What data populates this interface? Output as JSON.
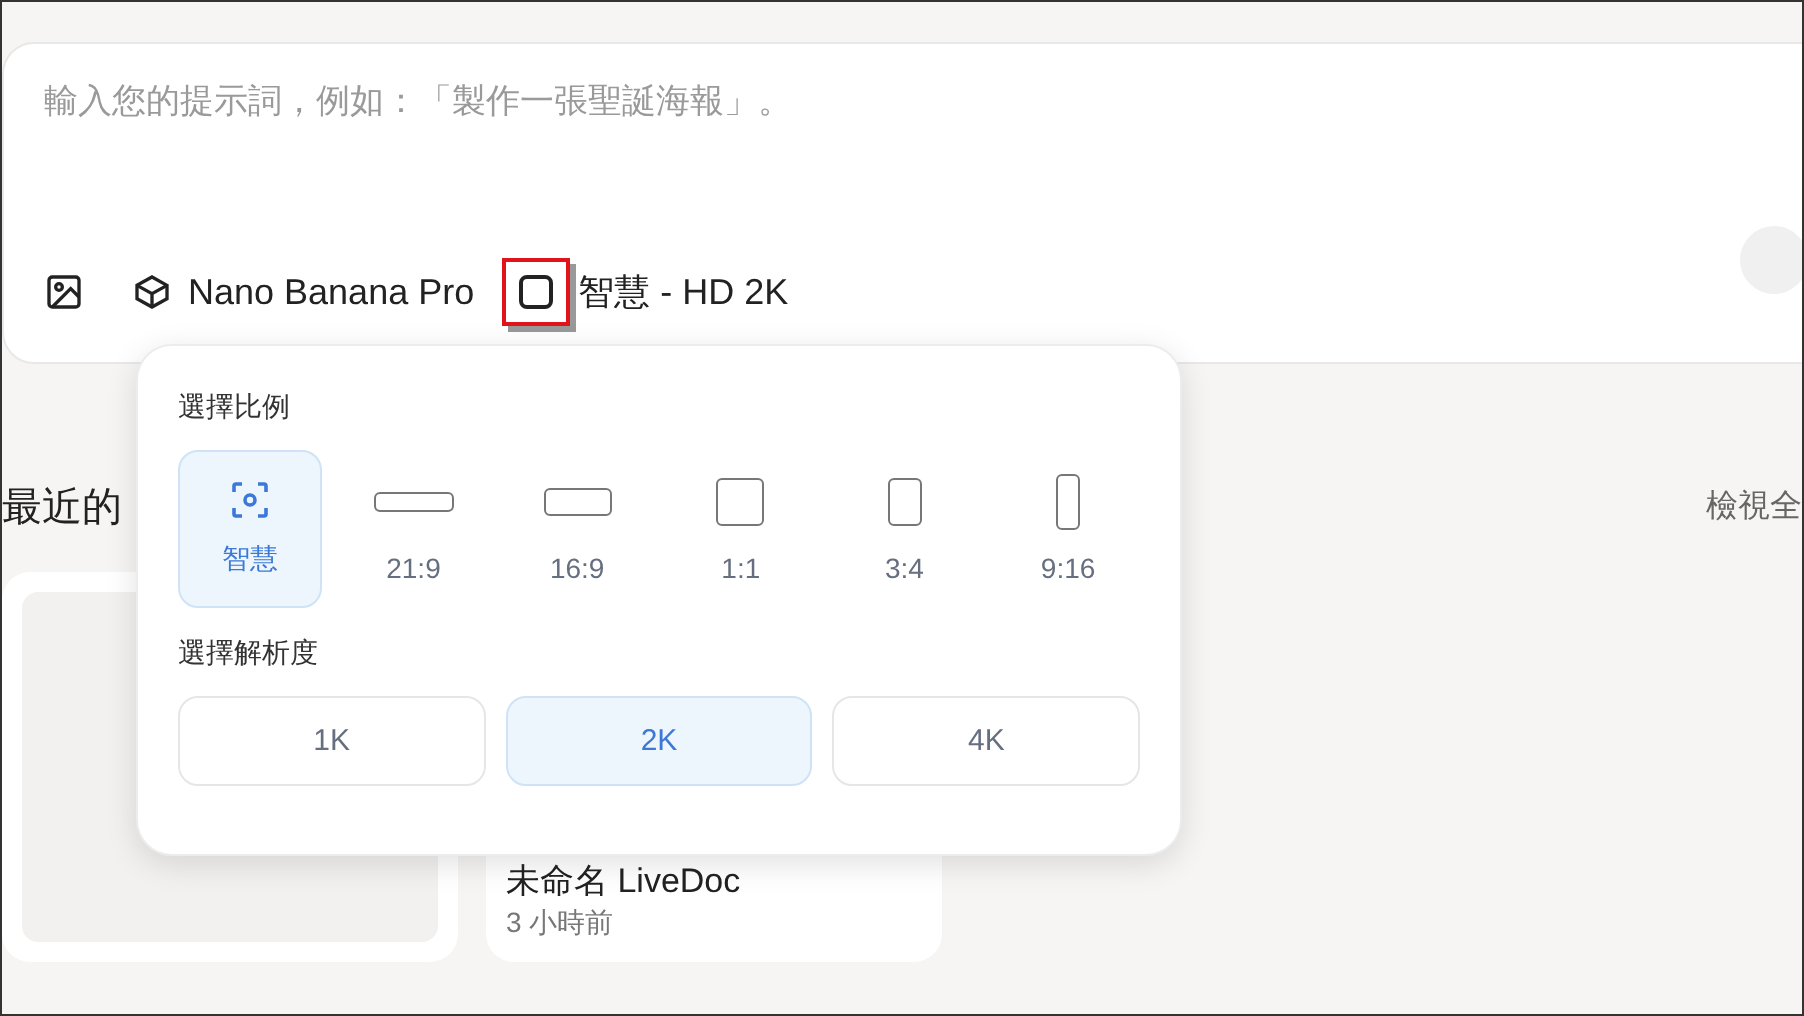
{
  "prompt": {
    "placeholder": "輸入您的提示詞，例如：「製作一張聖誕海報」。"
  },
  "toolbar": {
    "model": "Nano Banana Pro",
    "setting": "智慧 - HD 2K"
  },
  "popup": {
    "ratio_label": "選擇比例",
    "ratios": [
      {
        "label": "智慧",
        "kind": "auto",
        "selected": true
      },
      {
        "label": "21:9",
        "kind": "shape",
        "selected": false
      },
      {
        "label": "16:9",
        "kind": "shape",
        "selected": false
      },
      {
        "label": "1:1",
        "kind": "shape",
        "selected": false
      },
      {
        "label": "3:4",
        "kind": "shape",
        "selected": false
      },
      {
        "label": "9:16",
        "kind": "shape",
        "selected": false
      }
    ],
    "resolution_label": "選擇解析度",
    "resolutions": [
      {
        "label": "1K",
        "selected": false
      },
      {
        "label": "2K",
        "selected": true
      },
      {
        "label": "4K",
        "selected": false
      }
    ]
  },
  "recent": {
    "title": "最近的",
    "view_all": "檢視全",
    "cards": [
      {
        "kind": "blank"
      },
      {
        "kind": "doc",
        "title": "未命名 LiveDoc",
        "time": "3 小時前"
      }
    ]
  }
}
